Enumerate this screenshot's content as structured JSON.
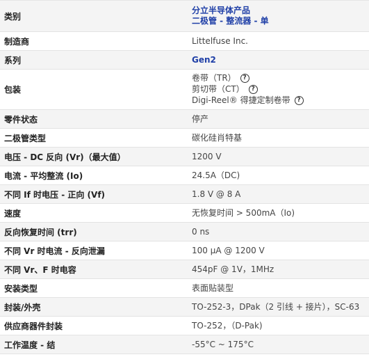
{
  "rows": [
    {
      "label": "类别",
      "lines": [
        "分立半导体产品",
        "二极管 - 整流器 - 单"
      ]
    },
    {
      "label": "制造商",
      "value": "Littelfuse Inc."
    },
    {
      "label": "系列",
      "value": "Gen2"
    },
    {
      "label": "包装",
      "options": [
        "卷带（TR）",
        "剪切带（CT）",
        "Digi-Reel® 得捷定制卷带"
      ]
    },
    {
      "label": "零件状态",
      "value": "停产"
    },
    {
      "label": "二极管类型",
      "value": "碳化硅肖特基"
    },
    {
      "label": "电压 - DC 反向 (Vr)（最大值）",
      "value": "1200 V"
    },
    {
      "label": "电流 - 平均整流 (Io)",
      "value": "24.5A（DC)"
    },
    {
      "label": "不同 If 时电压 - 正向 (Vf)",
      "value": "1.8 V @ 8 A"
    },
    {
      "label": "速度",
      "value": "无恢复时间 > 500mA（Io)"
    },
    {
      "label": "反向恢复时间 (trr)",
      "value": "0 ns"
    },
    {
      "label": "不同 Vr 时电流 - 反向泄漏",
      "value": "100 µA @ 1200 V"
    },
    {
      "label": "不同 Vr、F 时电容",
      "value": "454pF @ 1V，1MHz"
    },
    {
      "label": "安装类型",
      "value": "表面贴装型"
    },
    {
      "label": "封装/外壳",
      "value": "TO-252-3，DPak（2 引线 + 接片），SC-63"
    },
    {
      "label": "供应商器件封装",
      "value": "TO-252，（D-Pak)"
    },
    {
      "label": "工作温度 - 结",
      "value": "-55°C ~ 175°C"
    }
  ],
  "help_glyph": "?",
  "colors": {
    "link": "#1f3fa7",
    "row_alt": "#f4f4f4",
    "row": "#ffffff",
    "border": "#e3e3e3"
  },
  "icons": {
    "help": "question-circle-icon"
  }
}
